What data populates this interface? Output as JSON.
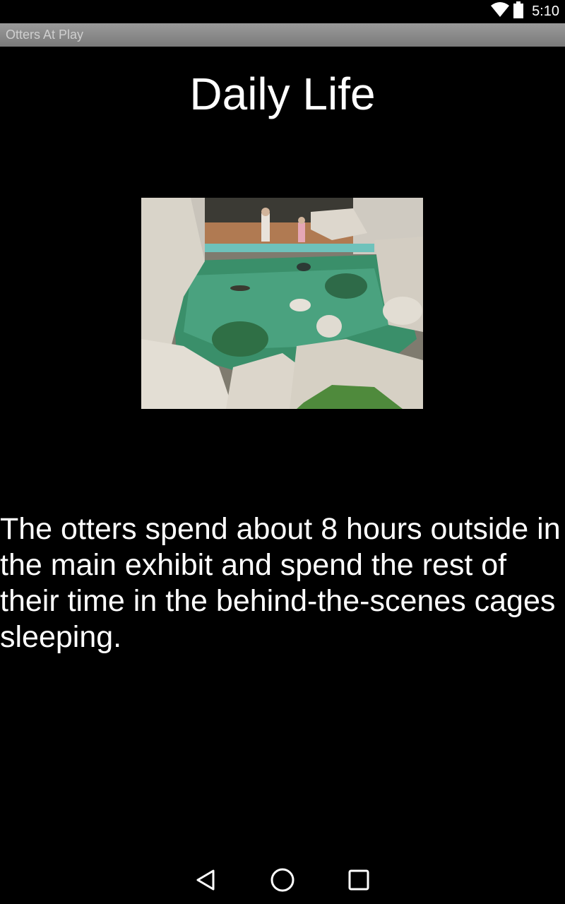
{
  "status_bar": {
    "time": "5:10",
    "icons": [
      "wifi-icon",
      "battery-icon"
    ]
  },
  "app": {
    "title": "Otters At Play"
  },
  "page": {
    "heading": "Daily Life",
    "image_description": "otter-exhibit-photo",
    "body": "The otters spend about 8 hours outside in the main exhibit and spend the rest of their time in the behind-the-scenes cages sleeping."
  },
  "nav_bar": {
    "buttons": [
      "back-icon",
      "home-icon",
      "recents-icon"
    ]
  },
  "colors": {
    "background": "#000000",
    "title_bar": "#8a8a8a",
    "text": "#ffffff"
  }
}
